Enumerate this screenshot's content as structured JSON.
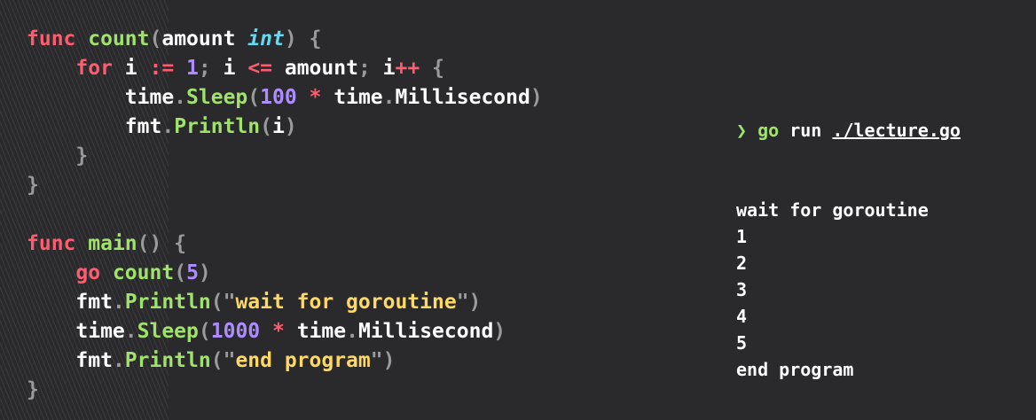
{
  "editor": {
    "lines": [
      [
        [
          "kw",
          "func"
        ],
        [
          "id",
          " "
        ],
        [
          "fn",
          "count"
        ],
        [
          "punc",
          "("
        ],
        [
          "id",
          "amount "
        ],
        [
          "ty",
          "int"
        ],
        [
          "punc",
          ") {"
        ]
      ],
      [
        [
          "id",
          "    "
        ],
        [
          "kw",
          "for"
        ],
        [
          "id",
          " i "
        ],
        [
          "op",
          ":="
        ],
        [
          "id",
          " "
        ],
        [
          "num",
          "1"
        ],
        [
          "punc",
          ";"
        ],
        [
          "id",
          " i "
        ],
        [
          "op",
          "<="
        ],
        [
          "id",
          " amount"
        ],
        [
          "punc",
          ";"
        ],
        [
          "id",
          " i"
        ],
        [
          "op",
          "++"
        ],
        [
          "id",
          " "
        ],
        [
          "punc",
          "{"
        ]
      ],
      [
        [
          "id",
          "        time"
        ],
        [
          "punc",
          "."
        ],
        [
          "fn",
          "Sleep"
        ],
        [
          "punc",
          "("
        ],
        [
          "num",
          "100"
        ],
        [
          "id",
          " "
        ],
        [
          "op",
          "*"
        ],
        [
          "id",
          " time"
        ],
        [
          "punc",
          "."
        ],
        [
          "id",
          "Millisecond"
        ],
        [
          "punc",
          ")"
        ]
      ],
      [
        [
          "id",
          "        fmt"
        ],
        [
          "punc",
          "."
        ],
        [
          "fn",
          "Println"
        ],
        [
          "punc",
          "("
        ],
        [
          "id",
          "i"
        ],
        [
          "punc",
          ")"
        ]
      ],
      [
        [
          "punc",
          "    }"
        ]
      ],
      [
        [
          "punc",
          "}"
        ]
      ],
      [],
      [
        [
          "kw",
          "func"
        ],
        [
          "id",
          " "
        ],
        [
          "fn",
          "main"
        ],
        [
          "punc",
          "() {"
        ]
      ],
      [
        [
          "id",
          "    "
        ],
        [
          "kw",
          "go"
        ],
        [
          "id",
          " "
        ],
        [
          "fn",
          "count"
        ],
        [
          "punc",
          "("
        ],
        [
          "num",
          "5"
        ],
        [
          "punc",
          ")"
        ]
      ],
      [
        [
          "id",
          "    fmt"
        ],
        [
          "punc",
          "."
        ],
        [
          "fn",
          "Println"
        ],
        [
          "punc",
          "(\""
        ],
        [
          "str",
          "wait for goroutine"
        ],
        [
          "punc",
          "\")"
        ]
      ],
      [
        [
          "id",
          "    time"
        ],
        [
          "punc",
          "."
        ],
        [
          "fn",
          "Sleep"
        ],
        [
          "punc",
          "("
        ],
        [
          "num",
          "1000"
        ],
        [
          "id",
          " "
        ],
        [
          "op",
          "*"
        ],
        [
          "id",
          " time"
        ],
        [
          "punc",
          "."
        ],
        [
          "id",
          "Millisecond"
        ],
        [
          "punc",
          ")"
        ]
      ],
      [
        [
          "id",
          "    fmt"
        ],
        [
          "punc",
          "."
        ],
        [
          "fn",
          "Println"
        ],
        [
          "punc",
          "(\""
        ],
        [
          "str",
          "end program"
        ],
        [
          "punc",
          "\")"
        ]
      ],
      [
        [
          "punc",
          "}"
        ]
      ]
    ]
  },
  "terminal": {
    "prompt_symbol": "❯",
    "command": "go",
    "command_rest": " run ",
    "command_arg": "./lecture.go",
    "output": [
      "wait for goroutine",
      "1",
      "2",
      "3",
      "4",
      "5",
      "end program"
    ]
  },
  "colors": {
    "background": "#2a2a2c",
    "keyword": "#ff5c6f",
    "function": "#9fe36a",
    "type": "#66d8ef",
    "number": "#ad8cff",
    "string": "#ffd866",
    "punctuation": "#9a9a9a"
  }
}
